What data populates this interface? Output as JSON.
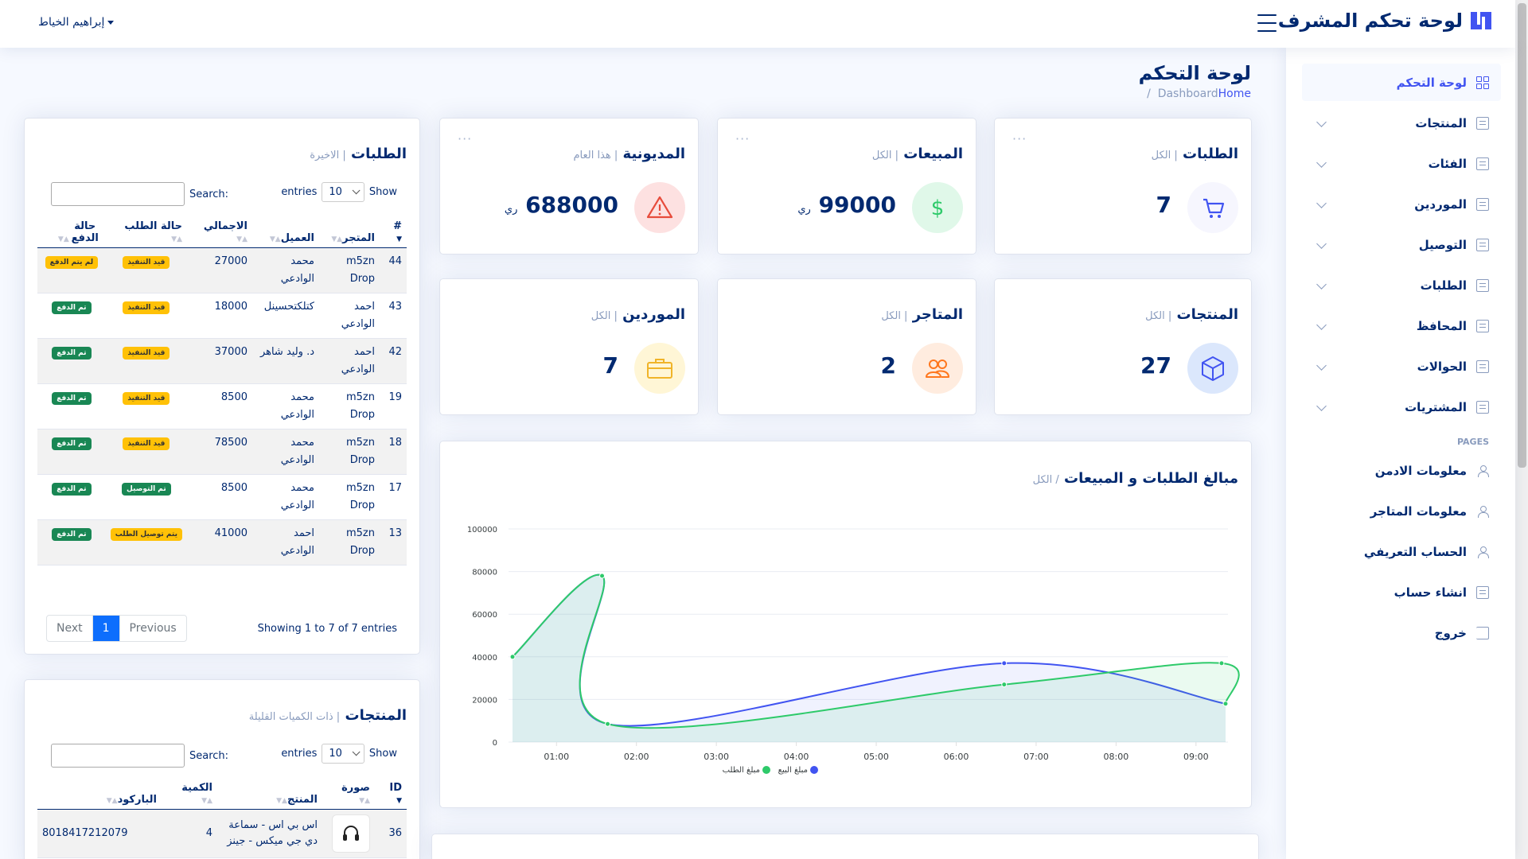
{
  "app": {
    "title": "لوحة تحكم المشرف",
    "user": "إبراهيم الخياط"
  },
  "colors": {
    "primary": "#4154f1",
    "navy": "#012970",
    "sales_series": "#4154f1",
    "orders_series": "#2eca6a"
  },
  "sidebar": {
    "items": [
      {
        "label": "لوحة التحكم",
        "icon": "grid-icon",
        "active": true
      },
      {
        "label": "المنتجات",
        "icon": "document-icon"
      },
      {
        "label": "الفئات",
        "icon": "document-icon"
      },
      {
        "label": "الموردين",
        "icon": "document-icon"
      },
      {
        "label": "التوصيل",
        "icon": "list-icon"
      },
      {
        "label": "الطلبات",
        "icon": "list-icon"
      },
      {
        "label": "المحافظ",
        "icon": "list-icon"
      },
      {
        "label": "الحوالات",
        "icon": "list-icon"
      },
      {
        "label": "المشتريات",
        "icon": "list-icon"
      }
    ],
    "pages_heading": "PAGES",
    "pages": [
      {
        "label": "معلومات الادمن",
        "icon": "person-icon"
      },
      {
        "label": "معلومات المتاجر",
        "icon": "person-icon"
      },
      {
        "label": "الحساب التعريفي",
        "icon": "person-icon"
      },
      {
        "label": "انشاء حساب",
        "icon": "card-icon"
      },
      {
        "label": "خروج",
        "icon": "logout-icon"
      }
    ]
  },
  "page": {
    "title": "لوحة التحكم",
    "breadcrumb_home": "Home",
    "breadcrumb_current": "Dashboard",
    "breadcrumb_sep": "/"
  },
  "stats": [
    {
      "title": "الطلبات",
      "sub": "| الكل",
      "value": "7",
      "icon": "cart-icon"
    },
    {
      "title": "المبيعات",
      "sub": "| الكل",
      "value": "99000",
      "unit": "ري",
      "icon": "dollar-icon"
    },
    {
      "title": "المديونية",
      "sub": "| هذا العام",
      "value": "688000",
      "unit": "ري",
      "icon": "warning-icon"
    },
    {
      "title": "المنتجات",
      "sub": "| الكل",
      "value": "27",
      "icon": "box-icon"
    },
    {
      "title": "المتاجر",
      "sub": "| الكل",
      "value": "2",
      "icon": "people-icon"
    },
    {
      "title": "الموردين",
      "sub": "| الكل",
      "value": "7",
      "icon": "briefcase-icon"
    }
  ],
  "chart_data": {
    "type": "area",
    "title": "مبالغ الطلبات و المبيعات",
    "subtitle": "/ الكل",
    "x_ticks": [
      "01:00",
      "02:00",
      "03:00",
      "04:00",
      "05:00",
      "06:00",
      "07:00",
      "08:00",
      "09:00"
    ],
    "y_ticks": [
      "0",
      "20000",
      "40000",
      "60000",
      "80000",
      "100000"
    ],
    "ylim": [
      0,
      100000
    ],
    "x_range": [
      0.4,
      9.4
    ],
    "series": [
      {
        "name": "مبلغ البيع",
        "x": [
          0.45,
          1.57,
          1.64,
          6.6,
          9.37
        ],
        "y": [
          40000,
          78000,
          8500,
          37000,
          18000
        ]
      },
      {
        "name": "مبلغ الطلب",
        "x": [
          0.45,
          1.57,
          1.64,
          6.6,
          9.32,
          9.37
        ],
        "y": [
          40000,
          78000,
          8500,
          27000,
          37000,
          18000
        ]
      }
    ],
    "legend_position": "bottom-center",
    "grid": true
  },
  "orders_table": {
    "title": "الطلبات",
    "sub": "| الاخيرة",
    "show_label": "Show",
    "entries_label": "entries",
    "page_size": "10",
    "search_label": "Search:",
    "columns": [
      "#",
      "المتجر",
      "العميل",
      "الاجمالي",
      "حالة الطلب",
      "حالة الدفع"
    ],
    "rows": [
      {
        "id": "44",
        "store": "m5zn Drop",
        "customer": "محمد الوادعي",
        "total": "27000",
        "status": "قيد التنفيذ",
        "status_type": "warn",
        "payment": "لم يتم الدفع",
        "payment_type": "warn"
      },
      {
        "id": "43",
        "store": "احمد الوادعي",
        "customer": "كتلكتحسينل",
        "total": "18000",
        "status": "قيد التنفيذ",
        "status_type": "warn",
        "payment": "تم الدفع",
        "payment_type": "ok"
      },
      {
        "id": "42",
        "store": "احمد الوادعي",
        "customer": "د. وليد شاهر",
        "total": "37000",
        "status": "قيد التنفيذ",
        "status_type": "warn",
        "payment": "تم الدفع",
        "payment_type": "ok"
      },
      {
        "id": "19",
        "store": "m5zn Drop",
        "customer": "محمد الوادعي",
        "total": "8500",
        "status": "قيد التنفيذ",
        "status_type": "warn",
        "payment": "تم الدفع",
        "payment_type": "ok"
      },
      {
        "id": "18",
        "store": "m5zn Drop",
        "customer": "محمد الوادعي",
        "total": "78500",
        "status": "قيد التنفيذ",
        "status_type": "warn",
        "payment": "تم الدفع",
        "payment_type": "ok"
      },
      {
        "id": "17",
        "store": "m5zn Drop",
        "customer": "محمد الوادعي",
        "total": "8500",
        "status": "تم التوصيل",
        "status_type": "ok",
        "payment": "تم الدفع",
        "payment_type": "ok"
      },
      {
        "id": "13",
        "store": "m5zn Drop",
        "customer": "احمد الوادعي",
        "total": "41000",
        "status": "يتم توصيل الطلب",
        "status_type": "warn",
        "payment": "تم الدفع",
        "payment_type": "ok"
      }
    ],
    "info": "Showing 1 to 7 of 7 entries",
    "pager": {
      "prev": "Previous",
      "current": "1",
      "next": "Next"
    }
  },
  "products_table": {
    "title": "المنتجات",
    "sub": "| ذات الكميات القليلة",
    "show_label": "Show",
    "entries_label": "entries",
    "page_size": "10",
    "search_label": "Search:",
    "columns": [
      "ID",
      "صورة",
      "المنتج",
      "الكمية",
      "الباركود"
    ],
    "rows": [
      {
        "id": "36",
        "image": "headset-icon",
        "name": "اس بي اس - سماعة دي جي ميكس - جينز",
        "qty": "4",
        "barcode": "8018417212079"
      }
    ]
  }
}
